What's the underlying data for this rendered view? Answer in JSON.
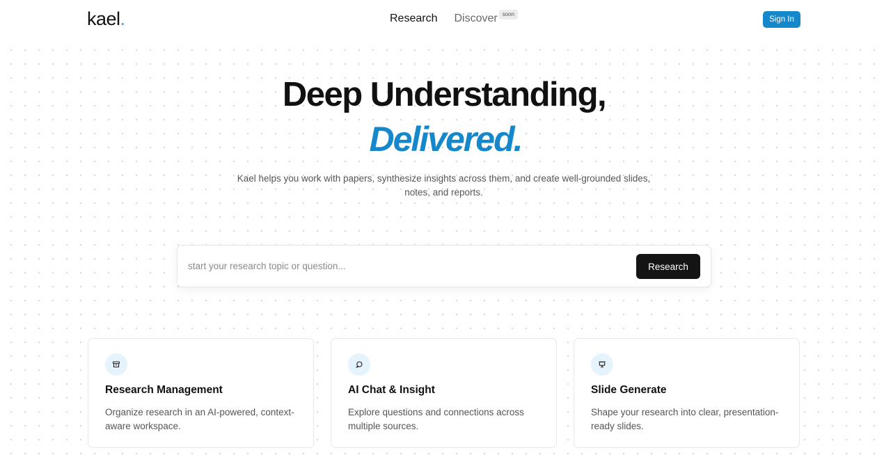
{
  "header": {
    "logo_text": "kael",
    "logo_dot": ".",
    "nav": [
      {
        "label": "Research"
      },
      {
        "label": "Discover",
        "badge": "soon"
      }
    ],
    "signin_label": "Sign In"
  },
  "hero": {
    "title": "Deep Understanding,",
    "accent": "Delivered.",
    "subtitle": "Kael helps you work with papers, synthesize insights across them, and create well-grounded slides, notes, and reports."
  },
  "search": {
    "placeholder": "start your research topic or question...",
    "value": "",
    "button_label": "Research"
  },
  "features": [
    {
      "icon": "archive-icon",
      "title": "Research Management",
      "description": "Organize research in an AI-powered, context-aware workspace."
    },
    {
      "icon": "chat-bubble-icon",
      "title": "AI Chat & Insight",
      "description": "Explore questions and connections across multiple sources."
    },
    {
      "icon": "presentation-icon",
      "title": "Slide Generate",
      "description": "Shape your research into clear, presentation-ready slides."
    }
  ],
  "colors": {
    "accent": "#1588cc",
    "logo_dot": "#2aa6dc",
    "dark_button": "#141414",
    "icon_bg": "#e5f3fc"
  }
}
